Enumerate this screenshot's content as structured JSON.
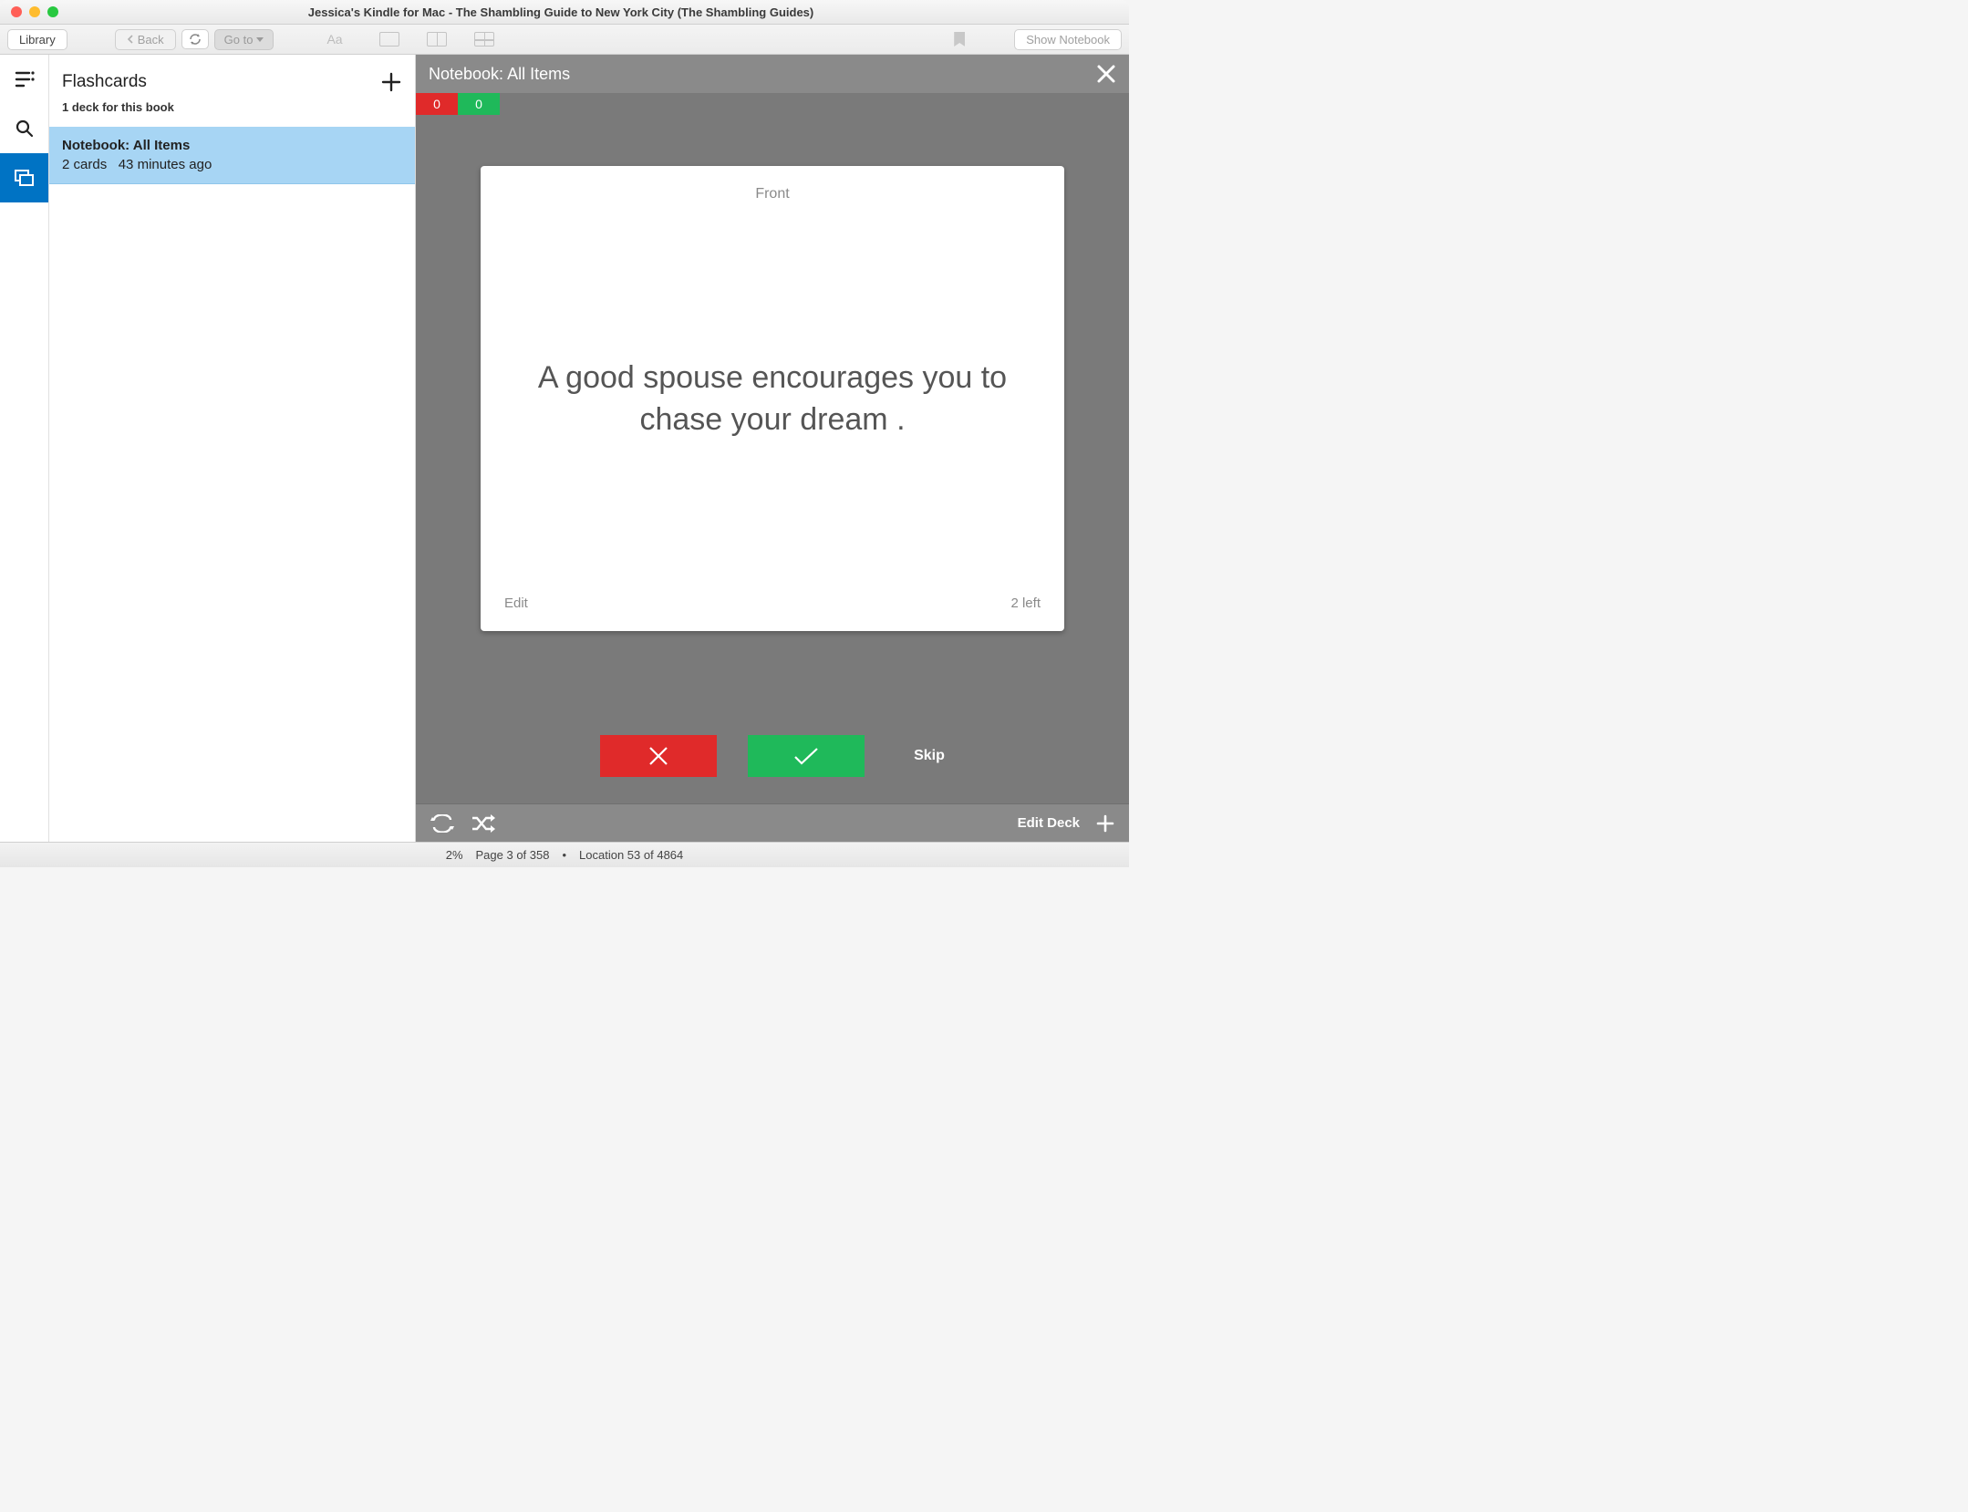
{
  "window": {
    "title": "Jessica's Kindle for Mac - The Shambling Guide to New York City (The Shambling Guides)"
  },
  "toolbar": {
    "library": "Library",
    "back": "Back",
    "goto": "Go to",
    "show_notebook": "Show Notebook"
  },
  "flashcards": {
    "title": "Flashcards",
    "subtitle": "1 deck for this book",
    "deck": {
      "name": "Notebook: All Items",
      "cards": "2 cards",
      "age": "43 minutes ago"
    }
  },
  "main": {
    "header": "Notebook: All Items",
    "count_red": "0",
    "count_green": "0",
    "card": {
      "side": "Front",
      "text": "A good spouse encourages you to chase your dream .",
      "edit": "Edit",
      "remaining": "2 left"
    },
    "skip": "Skip",
    "edit_deck": "Edit Deck"
  },
  "status": {
    "percent": "2%",
    "page": "Page 3 of 358",
    "location": "Location 53 of 4864"
  }
}
